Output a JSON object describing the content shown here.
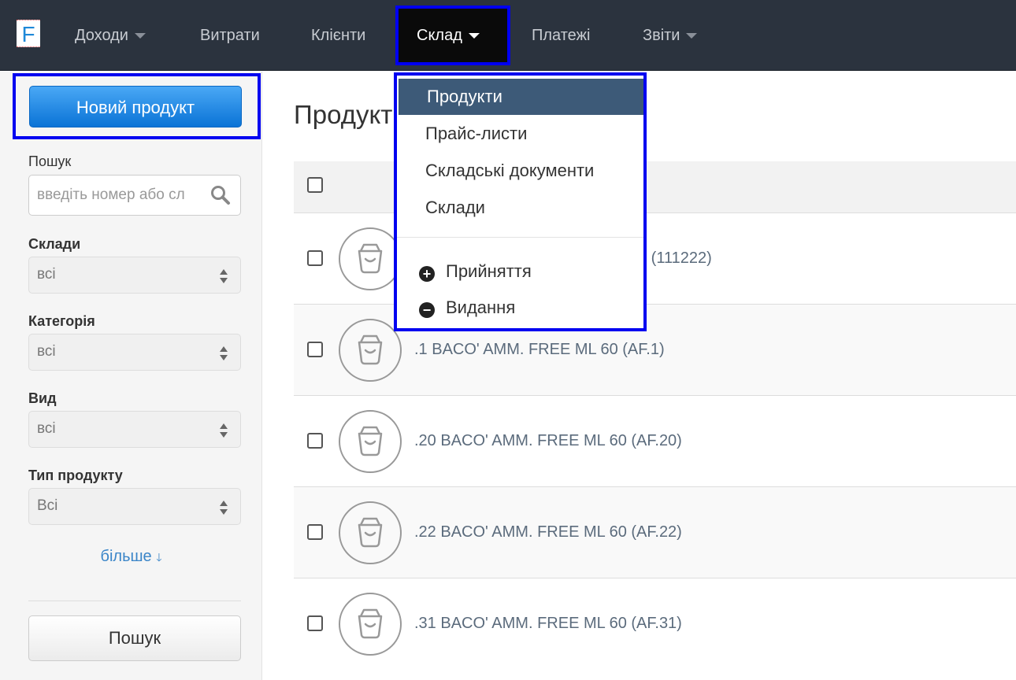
{
  "nav": {
    "logo": "F",
    "items": [
      {
        "label": "Доходи"
      },
      {
        "label": "Витрати"
      },
      {
        "label": "Клієнти"
      },
      {
        "label": "Склад"
      },
      {
        "label": "Платежі"
      },
      {
        "label": "Звіти"
      }
    ]
  },
  "sidebar": {
    "new_product": "Новий продукт",
    "search_label": "Пошук",
    "search_placeholder": "введіть номер або сл",
    "filters": [
      {
        "label": "Склади",
        "value": "всі"
      },
      {
        "label": "Категорія",
        "value": "всі"
      },
      {
        "label": "Вид",
        "value": "всі"
      },
      {
        "label": "Тип продукту",
        "value": "Всі"
      }
    ],
    "more": "більше",
    "search_button": "Пошук"
  },
  "main": {
    "title": "Продукти",
    "rows": [
      {
        "name": "0 (111222)"
      },
      {
        "name": ".1 BACO' AMM. FREE ML 60 (AF.1)"
      },
      {
        "name": ".20 BACO' AMM. FREE ML 60 (AF.20)"
      },
      {
        "name": ".22 BACO' AMM. FREE ML 60 (AF.22)"
      },
      {
        "name": ".31 BACO' AMM. FREE ML 60 (AF.31)"
      }
    ]
  },
  "dropdown": {
    "items": [
      "Продукти",
      "Прайс-листи",
      "Складські документи",
      "Склади"
    ],
    "actions": [
      {
        "label": "Прийняття",
        "icon": "+"
      },
      {
        "label": "Видання",
        "icon": "−"
      }
    ]
  }
}
